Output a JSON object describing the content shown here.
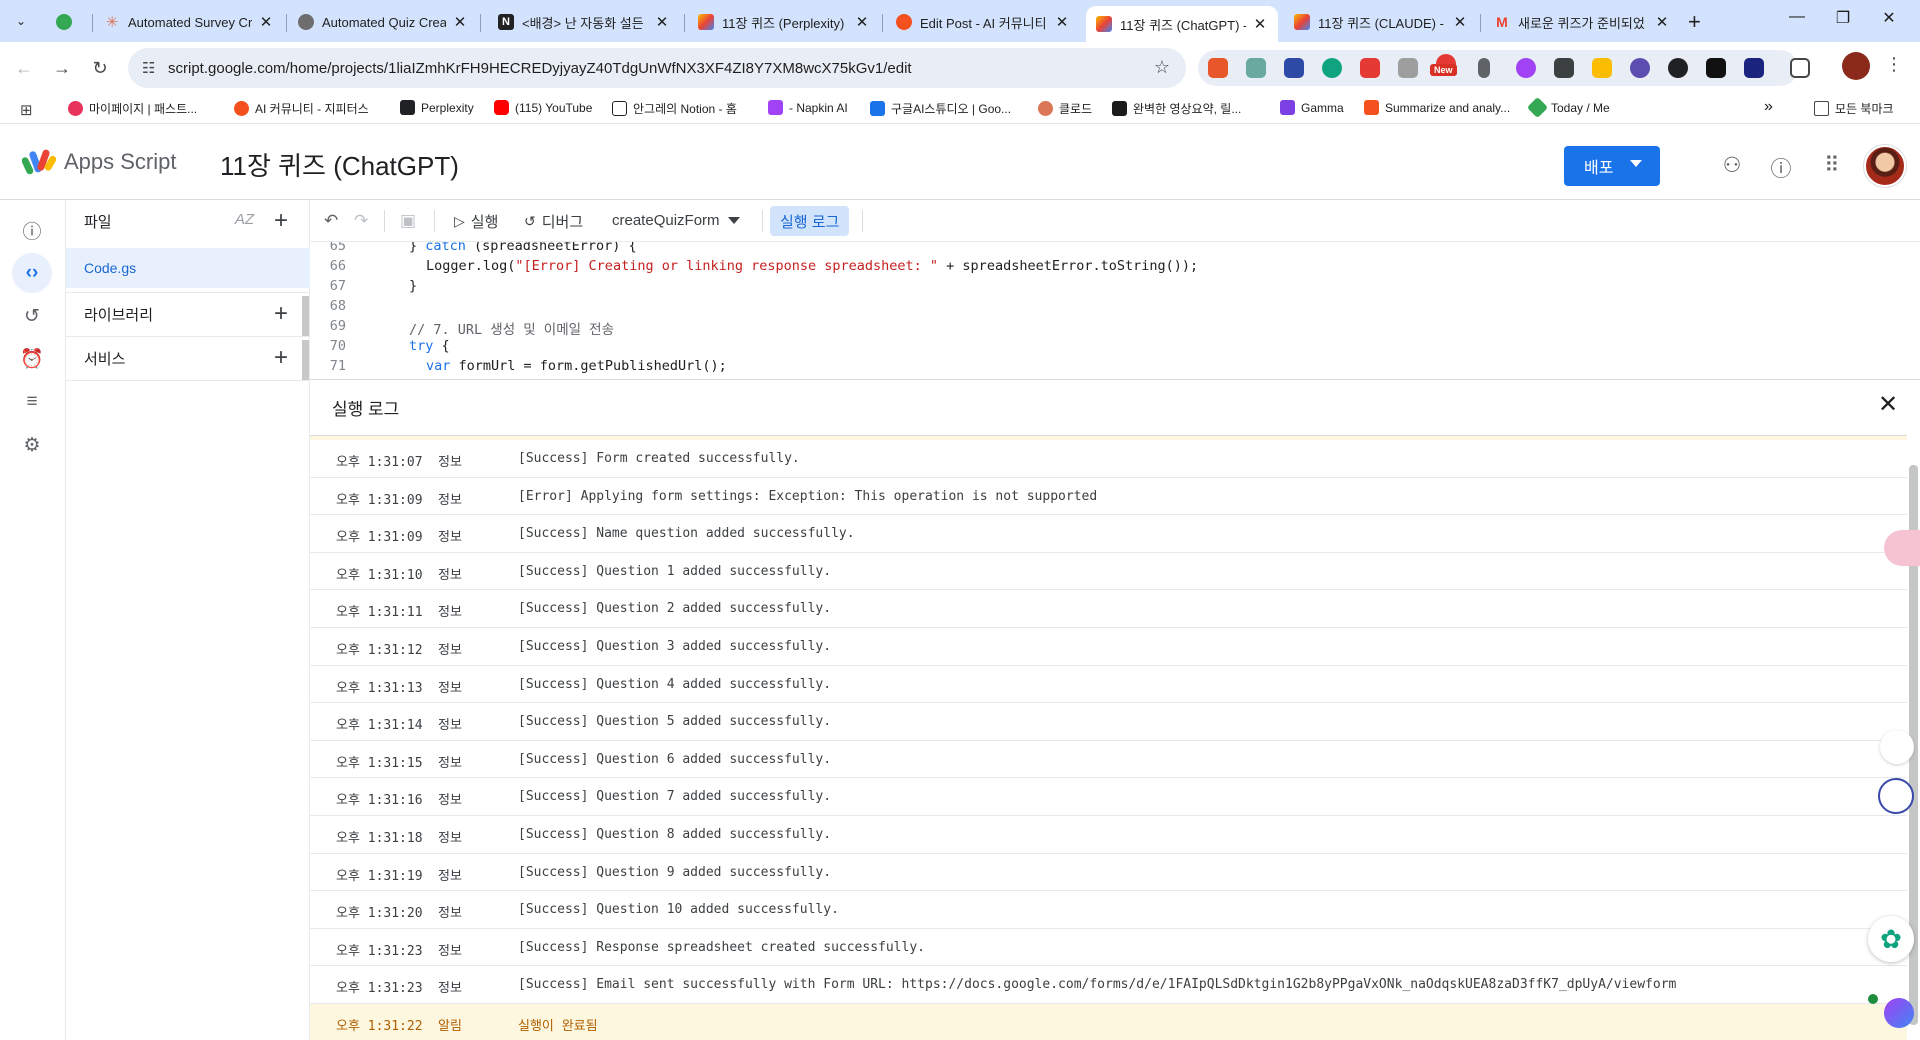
{
  "browser": {
    "tabs": [
      {
        "title": "",
        "active": false
      },
      {
        "title": "Automated Survey Cre",
        "active": false
      },
      {
        "title": "Automated Quiz Creat",
        "active": false
      },
      {
        "title": "<배경> 난 자동화 설든",
        "active": false
      },
      {
        "title": "11장 퀴즈 (Perplexity)",
        "active": false
      },
      {
        "title": "Edit Post - AI 커뮤니티",
        "active": false
      },
      {
        "title": "11장 퀴즈 (ChatGPT) -",
        "active": true
      },
      {
        "title": "11장 퀴즈 (CLAUDE) -",
        "active": false
      },
      {
        "title": "새로운 퀴즈가 준비되었",
        "active": false
      }
    ],
    "url": "script.google.com/home/projects/1liaIZmhKrFH9HECREDyjyayZ40TdgUnWfNX3XF4ZI8Y7XM8wcX75kGv1/edit",
    "extension_badge": "New",
    "bookmarks": [
      "마이페이지 | 패스트...",
      "AI 커뮤니티 - 지피터스",
      "Perplexity",
      "(115) YouTube",
      "안그레의 Notion - 홈",
      "- Napkin AI",
      "구글AI스튜디오 | Goo...",
      "클로드",
      "완벽한 영상요약, 릴...",
      "Gamma",
      "Summarize and analy...",
      "Today / Me"
    ],
    "bookmarks_overflow": "»",
    "all_bookmarks": "모든 북마크"
  },
  "app": {
    "product_name": "Apps Script",
    "project_title": "11장 퀴즈 (ChatGPT)",
    "deploy_label": "배포"
  },
  "files_panel": {
    "header": "파일",
    "sort_label": "AZ",
    "file": "Code.gs",
    "libraries": "라이브러리",
    "services": "서비스"
  },
  "editor_toolbar": {
    "run_label": "실행",
    "debug_label": "디버그",
    "function_name": "createQuizForm",
    "log_toggle": "실행 로그"
  },
  "code_lines": [
    {
      "n": "65",
      "text": "} catch (spreadsheetError) {"
    },
    {
      "n": "66",
      "text": "Logger.log(\"[Error] Creating or linking response spreadsheet: \" + spreadsheetError.toString());"
    },
    {
      "n": "67",
      "text": "}"
    },
    {
      "n": "68",
      "text": ""
    },
    {
      "n": "69",
      "text": "// 7. URL 생성 및 이메일 전송"
    },
    {
      "n": "70",
      "text": "try {"
    },
    {
      "n": "71",
      "text": "var formUrl = form.getPublishedUrl();"
    }
  ],
  "log_panel": {
    "title": "실행 로그",
    "rows": [
      {
        "time": "오후 1:31:07",
        "level": "정보",
        "message": "[Success] Form created successfully."
      },
      {
        "time": "오후 1:31:09",
        "level": "정보",
        "message": "[Error] Applying form settings: Exception: This operation is not supported"
      },
      {
        "time": "오후 1:31:09",
        "level": "정보",
        "message": "[Success] Name question added successfully."
      },
      {
        "time": "오후 1:31:10",
        "level": "정보",
        "message": "[Success] Question 1 added successfully."
      },
      {
        "time": "오후 1:31:11",
        "level": "정보",
        "message": "[Success] Question 2 added successfully."
      },
      {
        "time": "오후 1:31:12",
        "level": "정보",
        "message": "[Success] Question 3 added successfully."
      },
      {
        "time": "오후 1:31:13",
        "level": "정보",
        "message": "[Success] Question 4 added successfully."
      },
      {
        "time": "오후 1:31:14",
        "level": "정보",
        "message": "[Success] Question 5 added successfully."
      },
      {
        "time": "오후 1:31:15",
        "level": "정보",
        "message": "[Success] Question 6 added successfully."
      },
      {
        "time": "오후 1:31:16",
        "level": "정보",
        "message": "[Success] Question 7 added successfully."
      },
      {
        "time": "오후 1:31:18",
        "level": "정보",
        "message": "[Success] Question 8 added successfully."
      },
      {
        "time": "오후 1:31:19",
        "level": "정보",
        "message": "[Success] Question 9 added successfully."
      },
      {
        "time": "오후 1:31:20",
        "level": "정보",
        "message": "[Success] Question 10 added successfully."
      },
      {
        "time": "오후 1:31:23",
        "level": "정보",
        "message": "[Success] Response spreadsheet created successfully."
      },
      {
        "time": "오후 1:31:23",
        "level": "정보",
        "message": "[Success] Email sent successfully with Form URL: https://docs.google.com/forms/d/e/1FAIpQLSdDktgin1G2b8yPPgaVxONk_naOdqskUEA8zaD3ffK7_dpUyA/viewform"
      },
      {
        "time": "오후 1:31:22",
        "level": "알림",
        "message": "실행이 완료됨"
      }
    ]
  },
  "colors": {
    "accent": "#1a73e8",
    "tabstrip": "#d3e3fd",
    "notice_bg": "#fef7e0",
    "notice_text": "#b06000"
  }
}
